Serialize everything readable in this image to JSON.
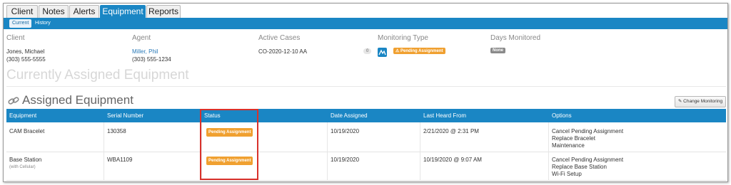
{
  "tabs": [
    "Client",
    "Notes",
    "Alerts",
    "Equipment",
    "Reports"
  ],
  "active_tab": "Equipment",
  "subtabs": [
    "Current",
    "History"
  ],
  "active_subtab": "Current",
  "client": {
    "label": "Client",
    "name": "Jones, Michael",
    "phone": "(303) 555-5555"
  },
  "agent": {
    "label": "Agent",
    "name": "Miller, Phil",
    "phone": "(303) 555-1234"
  },
  "active_cases": {
    "label": "Active Cases",
    "case": "CO-2020-12-10 AA",
    "count": "0"
  },
  "monitoring_type": {
    "label": "Monitoring Type",
    "status": "Pending Assignment"
  },
  "days_monitored": {
    "label": "Days Monitored",
    "value": "None"
  },
  "current_heading": "Currently Assigned Equipment",
  "assigned_heading": "Assigned Equipment",
  "change_button": "Change Monitoring",
  "table": {
    "headers": [
      "Equipment",
      "Serial Number",
      "Status",
      "Date Assigned",
      "Last Heard From",
      "Options"
    ],
    "rows": [
      {
        "equipment": "CAM Bracelet",
        "equipment_sub": "",
        "serial": "130358",
        "status": "Pending Assignment",
        "date_assigned": "10/19/2020",
        "last_heard": "2/21/2020 @ 2:31 PM",
        "options": [
          "Cancel Pending Assignment",
          "Replace Bracelet",
          "Maintenance"
        ]
      },
      {
        "equipment": "Base Station",
        "equipment_sub": "(with Cellular)",
        "serial": "WBA1109",
        "status": "Pending Assignment",
        "date_assigned": "10/19/2020",
        "last_heard": "10/19/2020 @ 9:07 AM",
        "options": [
          "Cancel Pending Assignment",
          "Replace Base Station",
          "Wi-Fi Setup"
        ]
      }
    ]
  },
  "colors": {
    "accent": "#1a86c4",
    "pending": "#f0a030",
    "highlight": "#d9312b",
    "link": "#2a7ab8"
  },
  "icons": [
    "chain-link-icon",
    "monitoring-type-icon",
    "warning-icon",
    "wrench-icon"
  ]
}
